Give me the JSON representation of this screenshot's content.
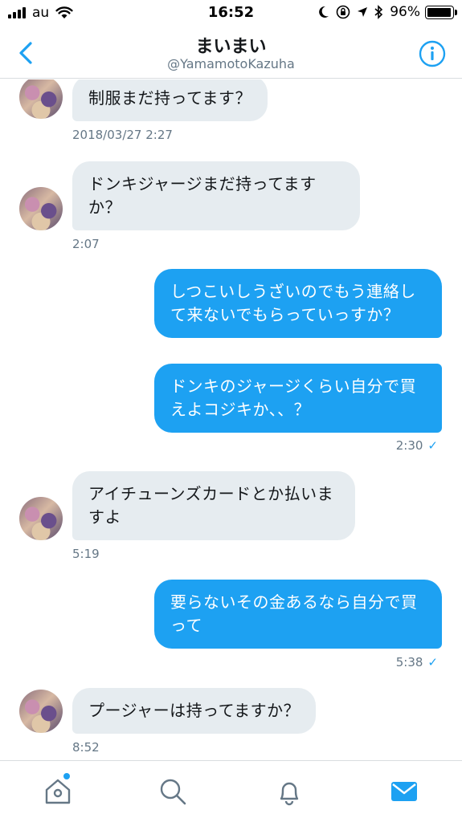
{
  "status_bar": {
    "carrier": "au",
    "time": "16:52",
    "battery_text": "96%",
    "battery_level": 0.96,
    "icons": [
      "signal-icon",
      "wifi-icon",
      "moon-icon",
      "orientation-lock-icon",
      "location-icon",
      "bluetooth-icon",
      "battery-icon"
    ]
  },
  "header": {
    "title": "まいまい",
    "handle": "@YamamotoKazuha",
    "back_icon": "chevron-left-icon",
    "info_icon": "info-icon"
  },
  "conversation": {
    "messages": [
      {
        "direction": "in",
        "text": "制服まだ持ってます？",
        "time": "2018/03/27 2:27"
      },
      {
        "direction": "in",
        "text": "ドンキジャージまだ持ってますか？",
        "time": "2:07"
      },
      {
        "direction": "out",
        "text": "しつこいしうざいのでもう連絡して来ないでもらっていっすか？"
      },
      {
        "direction": "out",
        "text": "ドンキのジャージくらい自分で買えよコジキか、、？",
        "time": "2:30",
        "read": "✓"
      },
      {
        "direction": "in",
        "text": "アイチューンズカードとか払いますよ",
        "time": "5:19"
      },
      {
        "direction": "out",
        "text": "要らないその金あるなら自分で買って",
        "time": "5:38",
        "read": "✓"
      },
      {
        "direction": "in",
        "text": "プージャーは持ってますか？",
        "time": "8:52"
      }
    ]
  },
  "tabbar": {
    "tabs": [
      "home-icon",
      "search-icon",
      "bell-icon",
      "envelope-icon"
    ],
    "active": "envelope-icon",
    "accent": "#1da1f2"
  },
  "colors": {
    "accent": "#1da1f2",
    "incoming_bubble": "#e6ecf0",
    "secondary_text": "#657786"
  }
}
